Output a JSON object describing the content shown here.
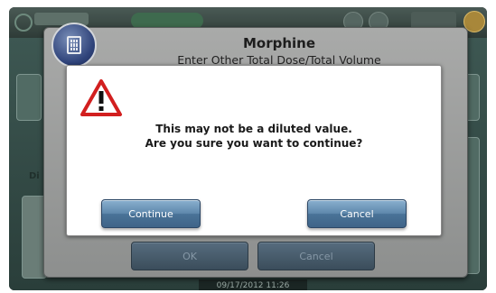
{
  "background_app": {
    "side_label": "Di",
    "date_time": "09/17/2012 11:26"
  },
  "dialog": {
    "icon": "pump-icon",
    "title": "Morphine",
    "subtitle": "Enter Other Total Dose/Total Volume",
    "ok_label": "OK",
    "cancel_label": "Cancel"
  },
  "alert": {
    "icon": "warning-icon",
    "message_line1": "This may not be a diluted value.",
    "message_line2": "Are you sure you want to continue?",
    "continue_label": "Continue",
    "cancel_label": "Cancel"
  },
  "colors": {
    "alert_button": "#4f789c",
    "warning_red": "#d21f1f",
    "dialog_gray": "#9c9d9c"
  }
}
